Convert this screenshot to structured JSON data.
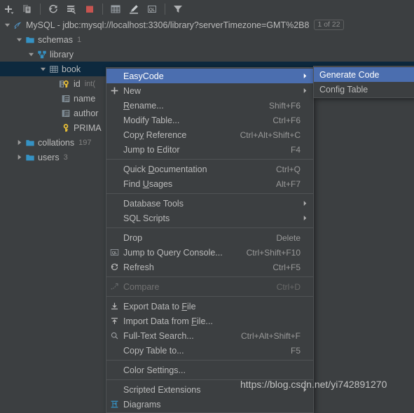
{
  "toolbar": {
    "buttons": [
      {
        "name": "add-datasource-button",
        "icon": "plus-dropdown-icon",
        "label": "+"
      },
      {
        "name": "duplicate-button",
        "icon": "copy-icon",
        "label": ""
      },
      {
        "name": "refresh-button",
        "icon": "refresh-icon",
        "label": ""
      },
      {
        "name": "datasource-properties-button",
        "icon": "wrench-stack-icon",
        "label": ""
      },
      {
        "name": "stop-button",
        "icon": "stop-square-icon",
        "label": ""
      },
      {
        "name": "open-table-editor-button",
        "icon": "table-grid-icon",
        "label": ""
      },
      {
        "name": "modify-table-button",
        "icon": "pencil-icon",
        "label": ""
      },
      {
        "name": "query-console-button",
        "icon": "ql-console-icon",
        "label": "QL"
      },
      {
        "name": "filter-button",
        "icon": "funnel-icon",
        "label": ""
      }
    ]
  },
  "tree": {
    "rows": [
      {
        "label": "MySQL - jdbc:mysql://localhost:3306/library?serverTimezone=GMT%2B8",
        "indent": 0,
        "twisty": "expanded",
        "icon": "mysql-icon",
        "sub": "",
        "badge": "1 of 22",
        "selected": false
      },
      {
        "label": "schemas",
        "indent": 1,
        "twisty": "expanded",
        "icon": "folder-icon",
        "sub": "1",
        "badge": "",
        "selected": false
      },
      {
        "label": "library",
        "indent": 2,
        "twisty": "expanded",
        "icon": "schema-icon",
        "sub": "",
        "badge": "",
        "selected": false
      },
      {
        "label": "book",
        "indent": 3,
        "twisty": "expanded",
        "icon": "table-icon",
        "sub": "",
        "badge": "",
        "selected": true
      },
      {
        "label": "id",
        "indent": 4,
        "twisty": "none",
        "icon": "primary-key-column-icon",
        "sub": "int(",
        "badge": "",
        "selected": false
      },
      {
        "label": "name",
        "indent": 4,
        "twisty": "none",
        "icon": "column-icon",
        "sub": "",
        "badge": "",
        "selected": false
      },
      {
        "label": "author",
        "indent": 4,
        "twisty": "none",
        "icon": "column-icon",
        "sub": "",
        "badge": "",
        "selected": false
      },
      {
        "label": "PRIMA",
        "indent": 4,
        "twisty": "none",
        "icon": "key-icon",
        "sub": "",
        "badge": "",
        "selected": false
      },
      {
        "label": "collations",
        "indent": 1,
        "twisty": "collapsed",
        "icon": "folder-icon",
        "sub": "197",
        "badge": "",
        "selected": false
      },
      {
        "label": "users",
        "indent": 1,
        "twisty": "collapsed",
        "icon": "folder-icon",
        "sub": "3",
        "badge": "",
        "selected": false
      }
    ]
  },
  "context_menu": {
    "items": [
      {
        "type": "item",
        "label": "EasyCode",
        "shortcut": "",
        "icon": "",
        "submenu": true,
        "highlighted": true,
        "disabled": false,
        "mnemonic": ""
      },
      {
        "type": "item",
        "label": "New",
        "shortcut": "",
        "icon": "plus-icon",
        "submenu": true,
        "highlighted": false,
        "disabled": false,
        "mnemonic": ""
      },
      {
        "type": "item",
        "label": "Rename...",
        "shortcut": "Shift+F6",
        "icon": "",
        "submenu": false,
        "highlighted": false,
        "disabled": false,
        "mnemonic": "R"
      },
      {
        "type": "item",
        "label": "Modify Table...",
        "shortcut": "Ctrl+F6",
        "icon": "",
        "submenu": false,
        "highlighted": false,
        "disabled": false,
        "mnemonic": ""
      },
      {
        "type": "item",
        "label": "Copy Reference",
        "shortcut": "Ctrl+Alt+Shift+C",
        "icon": "",
        "submenu": false,
        "highlighted": false,
        "disabled": false,
        "mnemonic": "y"
      },
      {
        "type": "item",
        "label": "Jump to Editor",
        "shortcut": "F4",
        "icon": "",
        "submenu": false,
        "highlighted": false,
        "disabled": false,
        "mnemonic": ""
      },
      {
        "type": "separator"
      },
      {
        "type": "item",
        "label": "Quick Documentation",
        "shortcut": "Ctrl+Q",
        "icon": "",
        "submenu": false,
        "highlighted": false,
        "disabled": false,
        "mnemonic": "D"
      },
      {
        "type": "item",
        "label": "Find Usages",
        "shortcut": "Alt+F7",
        "icon": "",
        "submenu": false,
        "highlighted": false,
        "disabled": false,
        "mnemonic": "U"
      },
      {
        "type": "separator"
      },
      {
        "type": "item",
        "label": "Database Tools",
        "shortcut": "",
        "icon": "",
        "submenu": true,
        "highlighted": false,
        "disabled": false,
        "mnemonic": ""
      },
      {
        "type": "item",
        "label": "SQL Scripts",
        "shortcut": "",
        "icon": "",
        "submenu": true,
        "highlighted": false,
        "disabled": false,
        "mnemonic": ""
      },
      {
        "type": "separator"
      },
      {
        "type": "item",
        "label": "Drop",
        "shortcut": "Delete",
        "icon": "",
        "submenu": false,
        "highlighted": false,
        "disabled": false,
        "mnemonic": ""
      },
      {
        "type": "item",
        "label": "Jump to Query Console...",
        "shortcut": "Ctrl+Shift+F10",
        "icon": "ql-console-icon",
        "submenu": false,
        "highlighted": false,
        "disabled": false,
        "mnemonic": ""
      },
      {
        "type": "item",
        "label": "Refresh",
        "shortcut": "Ctrl+F5",
        "icon": "refresh-icon",
        "submenu": false,
        "highlighted": false,
        "disabled": false,
        "mnemonic": ""
      },
      {
        "type": "separator"
      },
      {
        "type": "item",
        "label": "Compare",
        "shortcut": "Ctrl+D",
        "icon": "compare-icon",
        "submenu": false,
        "highlighted": false,
        "disabled": true,
        "mnemonic": ""
      },
      {
        "type": "separator"
      },
      {
        "type": "item",
        "label": "Export Data to File",
        "shortcut": "",
        "icon": "export-icon",
        "submenu": false,
        "highlighted": false,
        "disabled": false,
        "mnemonic": "F"
      },
      {
        "type": "item",
        "label": "Import Data from File...",
        "shortcut": "",
        "icon": "import-icon",
        "submenu": false,
        "highlighted": false,
        "disabled": false,
        "mnemonic": "F"
      },
      {
        "type": "item",
        "label": "Full-Text Search...",
        "shortcut": "Ctrl+Alt+Shift+F",
        "icon": "search-icon",
        "submenu": false,
        "highlighted": false,
        "disabled": false,
        "mnemonic": ""
      },
      {
        "type": "item",
        "label": "Copy Table to...",
        "shortcut": "F5",
        "icon": "",
        "submenu": false,
        "highlighted": false,
        "disabled": false,
        "mnemonic": ""
      },
      {
        "type": "separator"
      },
      {
        "type": "item",
        "label": "Color Settings...",
        "shortcut": "",
        "icon": "",
        "submenu": false,
        "highlighted": false,
        "disabled": false,
        "mnemonic": ""
      },
      {
        "type": "separator"
      },
      {
        "type": "item",
        "label": "Scripted Extensions",
        "shortcut": "",
        "icon": "",
        "submenu": true,
        "highlighted": false,
        "disabled": false,
        "mnemonic": ""
      },
      {
        "type": "item",
        "label": "Diagrams",
        "shortcut": "",
        "icon": "diagram-icon",
        "submenu": false,
        "highlighted": false,
        "disabled": false,
        "mnemonic": ""
      }
    ]
  },
  "submenu": {
    "items": [
      {
        "label": "Generate Code",
        "highlighted": true
      },
      {
        "label": "Config Table",
        "highlighted": false
      }
    ]
  },
  "watermark": {
    "text": "https://blog.csdn.net/yi742891270"
  },
  "colors": {
    "background": "#3c3f41",
    "menu_background": "#3c3f41",
    "highlight": "#4b6eaf",
    "selected_row": "#0d293e",
    "text": "#bbbbbb",
    "muted_text": "#808080",
    "folder_blue": "#3592c4",
    "key_yellow": "#e8bf36",
    "stop_red": "#c75450"
  }
}
